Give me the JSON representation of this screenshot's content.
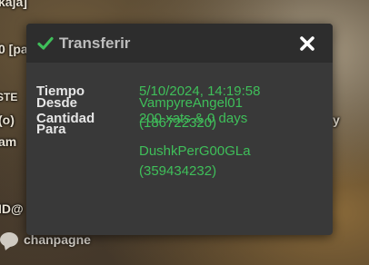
{
  "background": {
    "fragments": [
      "kaja]",
      "0 [pa",
      "STE",
      "(o)",
      "am",
      "y",
      "ID@"
    ],
    "chat_user": "chanpagne"
  },
  "dialog": {
    "title": "Transferir",
    "fields": {
      "tiempo_label": "Tiempo",
      "tiempo_value": "5/10/2024, 14:19:58",
      "cantidad_label": "Cantidad",
      "cantidad_value": "200 xats & 0 days",
      "desde_label": "Desde",
      "desde_name": "VampyreAngel01",
      "desde_id": "(186722320)",
      "para_label": "Para",
      "para_name": "DushkPerG00GLa",
      "para_id": "(359434232)"
    }
  },
  "colors": {
    "accent_green": "#3fbf5a",
    "dialog_bg": "#393939",
    "header_bg": "#2d2d2d"
  },
  "icons": {
    "title_icon": "check-icon",
    "close": "close-icon"
  }
}
